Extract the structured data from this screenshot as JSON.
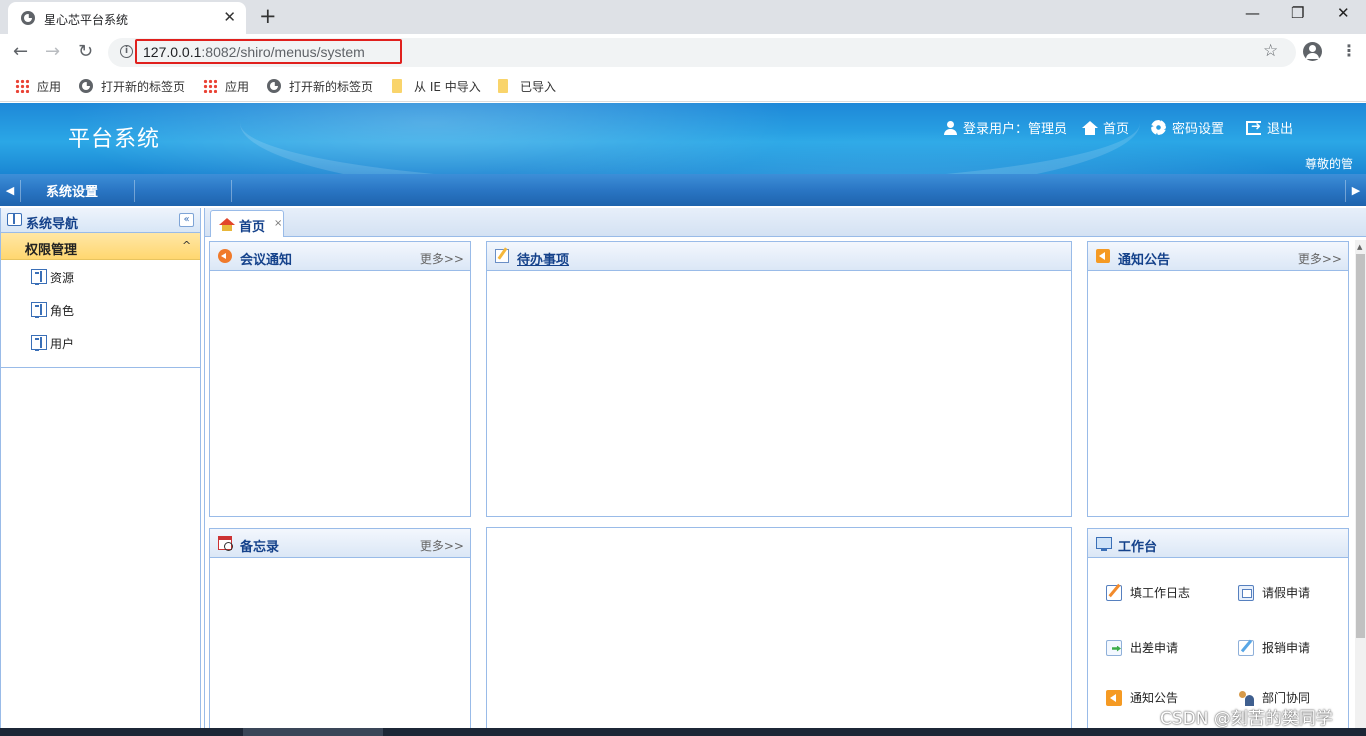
{
  "browser": {
    "tab_title": "星心芯平台系统",
    "tab_close": "✕",
    "new_tab": "+",
    "window_controls": {
      "minimize": "—",
      "restore": "❐",
      "close": "✕"
    },
    "nav": {
      "back": "←",
      "forward": "→",
      "reload": "↻"
    },
    "url_host": "127.0.0.1",
    "url_rest": ":8082/shiro/menus/system",
    "star": "☆",
    "menu": "⋮",
    "bookmarks": [
      {
        "label": "应用",
        "icon": "apps-grid-icon"
      },
      {
        "label": "打开新的标签页",
        "icon": "globe-icon"
      },
      {
        "label": "应用",
        "icon": "apps-grid-icon"
      },
      {
        "label": "打开新的标签页",
        "icon": "globe-icon"
      },
      {
        "label": "从 IE 中导入",
        "icon": "folder-icon"
      },
      {
        "label": "已导入",
        "icon": "folder-icon"
      }
    ]
  },
  "header": {
    "title": "平台系统",
    "login_user": "登录用户：管理员",
    "home": "首页",
    "password": "密码设置",
    "logout": "退出",
    "welcome": "尊敬的管"
  },
  "modbar": {
    "tab": "系统设置",
    "left_arrow": "◀",
    "right_arrow": "▶"
  },
  "sidebar": {
    "title": "系统导航",
    "collapse": "«",
    "group": {
      "label": "权限管理",
      "caret": "^"
    },
    "items": [
      {
        "label": "资源"
      },
      {
        "label": "角色"
      },
      {
        "label": "用户"
      }
    ]
  },
  "main": {
    "home_tab": {
      "label": "首页",
      "close": "×"
    },
    "portlets": {
      "meeting": {
        "title": "会议通知",
        "more": "更多>>"
      },
      "todo": {
        "title": "待办事项"
      },
      "notice": {
        "title": "通知公告",
        "more": "更多>>"
      },
      "memo": {
        "title": "备忘录",
        "more": "更多>>"
      },
      "workbench": {
        "title": "工作台",
        "items": [
          {
            "label": "填工作日志"
          },
          {
            "label": "请假申请"
          },
          {
            "label": "出差申请"
          },
          {
            "label": "报销申请"
          },
          {
            "label": "通知公告"
          },
          {
            "label": "部门协同"
          }
        ]
      }
    }
  },
  "watermark": "CSDN @刻苦的樊同学",
  "colors": {
    "url_highlight": "#e0201d",
    "header_blue": "#2ba7e6",
    "group_yellow": "#ffd770",
    "link_blue": "#15428b"
  }
}
